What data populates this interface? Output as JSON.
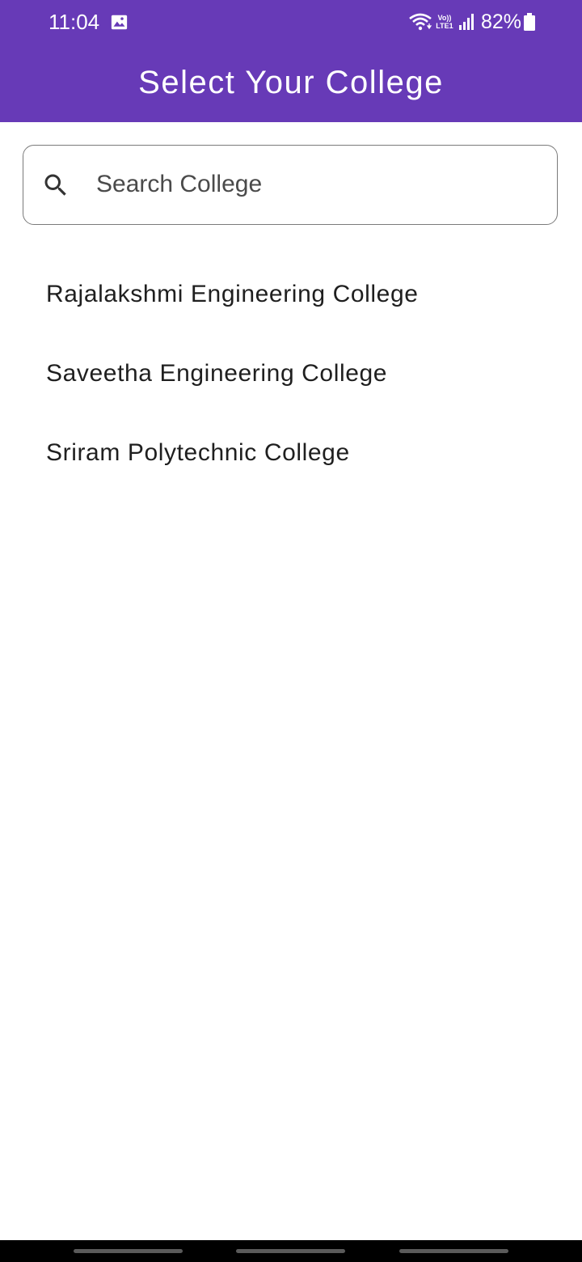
{
  "status_bar": {
    "time": "11:04",
    "network_top": "Vo))",
    "network_bottom": "LTE1",
    "battery": "82%"
  },
  "app_bar": {
    "title": "Select Your College",
    "color": "#673ab7"
  },
  "search": {
    "placeholder": "Search College",
    "value": "",
    "icon": "search-icon"
  },
  "colleges": [
    {
      "name": "Rajalakshmi Engineering College"
    },
    {
      "name": "Saveetha Engineering College"
    },
    {
      "name": "Sriram Polytechnic College"
    }
  ]
}
